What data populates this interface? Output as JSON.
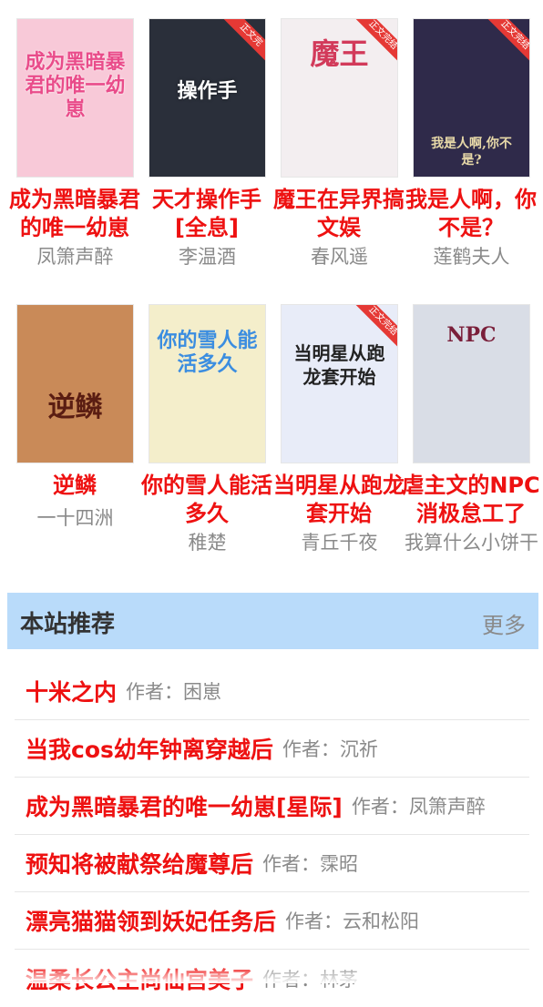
{
  "books": [
    {
      "title": "成为黑暗暴君的唯一幼崽",
      "author": "凤箫声醉",
      "cover_text": "成为黑暗暴君的唯一幼崽",
      "cover_bg": "#f8c9d8",
      "cover_fg": "#e94c8a",
      "ribbon": ""
    },
    {
      "title": "天才操作手[全息]",
      "author": "李温酒",
      "cover_text": "操作手",
      "cover_bg": "#2a2f3a",
      "cover_fg": "#ffffff",
      "ribbon": "正文完"
    },
    {
      "title": "魔王在异界搞文娱",
      "author": "春风遥",
      "cover_text": "魔王",
      "cover_bg": "#f3eef0",
      "cover_fg": "#d23a5a",
      "ribbon": "正文完结"
    },
    {
      "title": "我是人啊，你不是？",
      "author": "莲鹤夫人",
      "cover_text": "我是人啊,你不是?",
      "cover_bg": "#2f2a4a",
      "cover_fg": "#e8d9a8",
      "ribbon": "正文完结"
    },
    {
      "title": "逆鳞",
      "author": "一十四洲",
      "cover_text": "逆鳞",
      "cover_bg": "#c98a58",
      "cover_fg": "#5a1d12",
      "ribbon": ""
    },
    {
      "title": "你的雪人能活多久",
      "author": "稚楚",
      "cover_text": "你的雪人能活多久",
      "cover_bg": "#f4eecb",
      "cover_fg": "#3b8de0",
      "ribbon": ""
    },
    {
      "title": "当明星从跑龙套开始",
      "author": "青丘千夜",
      "cover_text": "当明星从跑龙套开始",
      "cover_bg": "#e8ecf8",
      "cover_fg": "#222222",
      "ribbon": "正文完结"
    },
    {
      "title": "虐主文的NPC消极怠工了",
      "author": "我算什么小饼干",
      "cover_text": "NPC",
      "cover_bg": "#d9dde6",
      "cover_fg": "#7a1f3a",
      "ribbon": ""
    }
  ],
  "recommend": {
    "title": "本站推荐",
    "more": "更多",
    "by_label": "作者：",
    "items": [
      {
        "name": "十米之内",
        "author": "困崽"
      },
      {
        "name": "当我cos幼年钟离穿越后",
        "author": "沉祈"
      },
      {
        "name": "成为黑暗暴君的唯一幼崽[星际]",
        "author": "凤箫声醉"
      },
      {
        "name": "预知将被献祭给魔尊后",
        "author": "霂昭"
      },
      {
        "name": "漂亮猫猫领到妖妃任务后",
        "author": "云和松阳"
      },
      {
        "name": "温柔长公主尚仙宫美子",
        "author": "林茅"
      }
    ]
  }
}
